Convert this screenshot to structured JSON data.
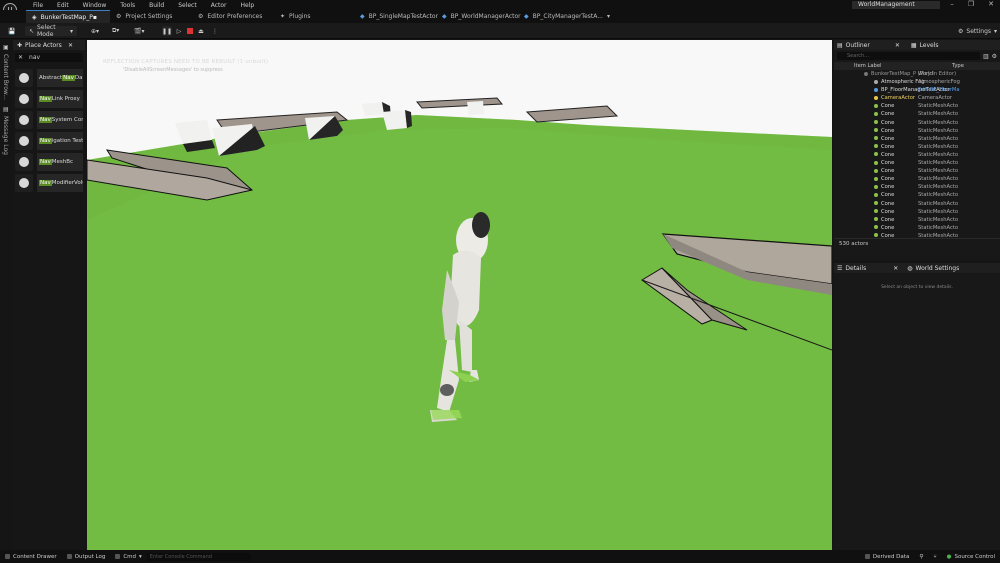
{
  "menubar": {
    "items": [
      "File",
      "Edit",
      "Window",
      "Tools",
      "Build",
      "Select",
      "Actor",
      "Help"
    ],
    "window_title": "WorldManagement",
    "controls": [
      "–",
      "❐",
      "✕"
    ]
  },
  "tabs": [
    {
      "label": "BunkerTestMap_P▪",
      "active": true
    },
    {
      "label": "Project Settings"
    },
    {
      "label": "Editor Preferences"
    },
    {
      "label": "Plugins"
    },
    {
      "label": "BP_SingleMapTestActor"
    },
    {
      "label": "BP_WorldManagerActor"
    },
    {
      "label": "BP_CityManagerTestA..."
    }
  ],
  "toolbar": {
    "mode_label": "Select Mode",
    "settings_label": "Settings"
  },
  "left_sidebar": {
    "content_browser": "Content Brow...",
    "message_log": "Message Log"
  },
  "place_actors": {
    "title": "Place Actors",
    "search_value": "nav",
    "items": [
      {
        "pre": "Abstract ",
        "hl": "Nav",
        "post": " Da"
      },
      {
        "pre": "",
        "hl": "Nav",
        "post": " Link Proxy"
      },
      {
        "pre": "",
        "hl": "Nav",
        "post": " System Con"
      },
      {
        "pre": "",
        "hl": "Nav",
        "post": "igation Testi"
      },
      {
        "pre": "",
        "hl": "Nav",
        "post": "MeshBc"
      },
      {
        "pre": "",
        "hl": "Nav",
        "post": "ModifierVolu"
      }
    ]
  },
  "viewport": {
    "warning": "REFLECTION CAPTURES NEED TO BE REBUILT (1 unbuilt)",
    "warning_sub": "'DisableAllScreenMessages' to suppress"
  },
  "outliner": {
    "tab": "Outliner",
    "tab2": "Levels",
    "search_placeholder": "Search...",
    "col_label": "Item Label",
    "col_type": "Type",
    "rows": [
      {
        "name": "BunkerTestMap_P (Play In Editor)",
        "type": "World"
      },
      {
        "name": "Atmospheric Fog",
        "type": "AtmosphericFog"
      },
      {
        "name": "BP_FloorManagerTestActor",
        "type": "Edit BP_FloorMa"
      },
      {
        "name": "CameraActor",
        "type": "CameraActor"
      },
      {
        "name": "Cone",
        "type": "StaticMeshActo"
      },
      {
        "name": "Cone",
        "type": "StaticMeshActo"
      },
      {
        "name": "Cone",
        "type": "StaticMeshActo"
      },
      {
        "name": "Cone",
        "type": "StaticMeshActo"
      },
      {
        "name": "Cone",
        "type": "StaticMeshActo"
      },
      {
        "name": "Cone",
        "type": "StaticMeshActo"
      },
      {
        "name": "Cone",
        "type": "StaticMeshActo"
      },
      {
        "name": "Cone",
        "type": "StaticMeshActo"
      },
      {
        "name": "Cone",
        "type": "StaticMeshActo"
      },
      {
        "name": "Cone",
        "type": "StaticMeshActo"
      },
      {
        "name": "Cone",
        "type": "StaticMeshActo"
      },
      {
        "name": "Cone",
        "type": "StaticMeshActo"
      },
      {
        "name": "Cone",
        "type": "StaticMeshActo"
      },
      {
        "name": "Cone",
        "type": "StaticMeshActo"
      },
      {
        "name": "Cone",
        "type": "StaticMeshActo"
      },
      {
        "name": "Cone",
        "type": "StaticMeshActo"
      },
      {
        "name": "Cone",
        "type": "StaticMeshActo"
      },
      {
        "name": "Cone",
        "type": "StaticMeshActo"
      },
      {
        "name": "Cone",
        "type": "StaticMeshActo"
      },
      {
        "name": "Cone",
        "type": "StaticMeshActo"
      },
      {
        "name": "Cone",
        "type": "StaticMeshActo"
      }
    ],
    "count": "530 actors"
  },
  "details": {
    "tab": "Details",
    "tab2": "World Settings",
    "empty_msg": "Select an object to view details."
  },
  "statusbar": {
    "content_drawer": "Content Drawer",
    "output_log": "Output Log",
    "cmd": "Cmd",
    "console_placeholder": "Enter Console Command",
    "derived_data": "Derived Data",
    "source_control": "Source Control"
  }
}
